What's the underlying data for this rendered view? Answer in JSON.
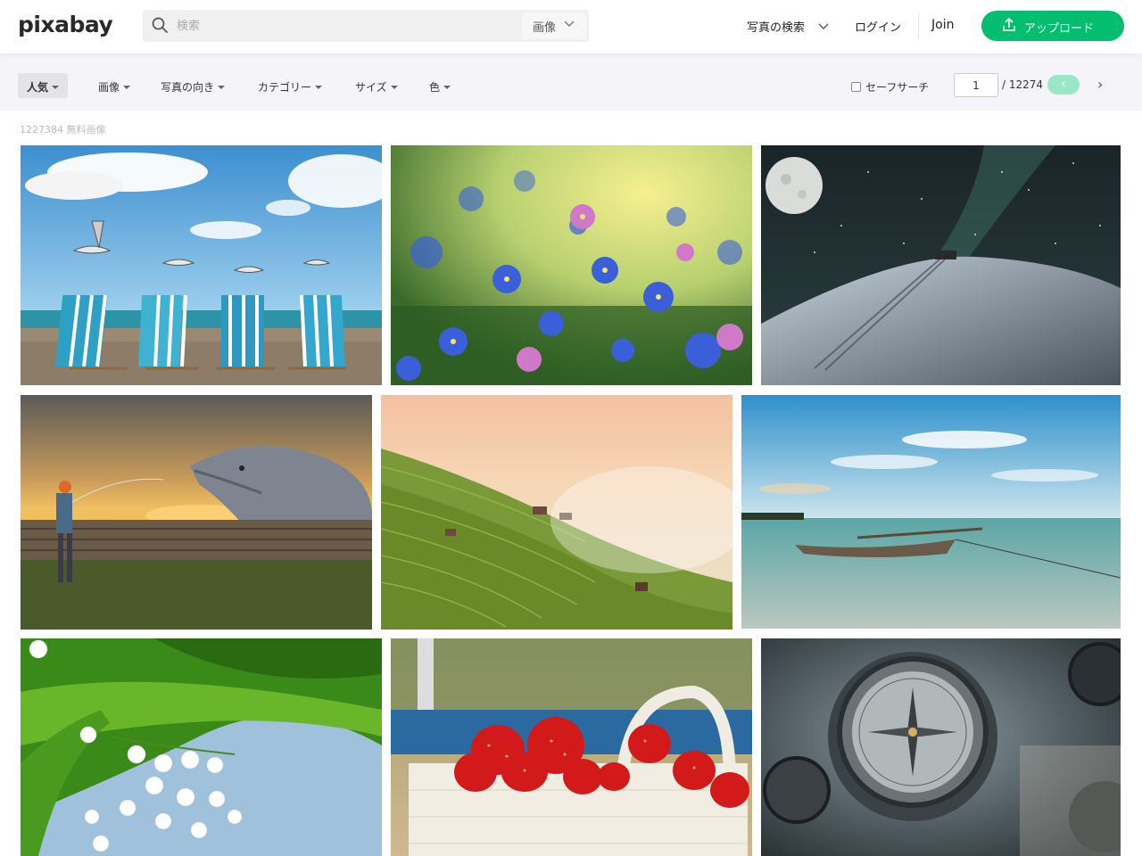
{
  "header": {
    "logo": "pixabay",
    "search_placeholder": "検索",
    "search_type": "画像",
    "explore_label": "写真の検索",
    "login_label": "ログイン",
    "join_label": "Join",
    "upload_label": "アップロード",
    "colors": {
      "accent": "#02be6e",
      "accent_light": "#9be6c5"
    }
  },
  "filters": {
    "items": [
      {
        "label": "人気",
        "active": true
      },
      {
        "label": "画像"
      },
      {
        "label": "写真の向き"
      },
      {
        "label": "カテゴリー"
      },
      {
        "label": "サイズ"
      },
      {
        "label": "色"
      }
    ],
    "safesearch_label": "セーフサーチ",
    "page_current": "1",
    "page_total": "/ 12274"
  },
  "result_count": "1227384 無料画像",
  "photos": [
    {
      "subject": "seagulls-beach-chairs"
    },
    {
      "subject": "blue-forget-me-not-flowers"
    },
    {
      "subject": "moon-milky-way-desert"
    },
    {
      "subject": "fisherman-dolphin-sunset"
    },
    {
      "subject": "rice-terraces-misty"
    },
    {
      "subject": "boat-low-tide-beach"
    },
    {
      "subject": "lily-of-the-valley"
    },
    {
      "subject": "strawberries-basket"
    },
    {
      "subject": "vintage-compass"
    }
  ]
}
